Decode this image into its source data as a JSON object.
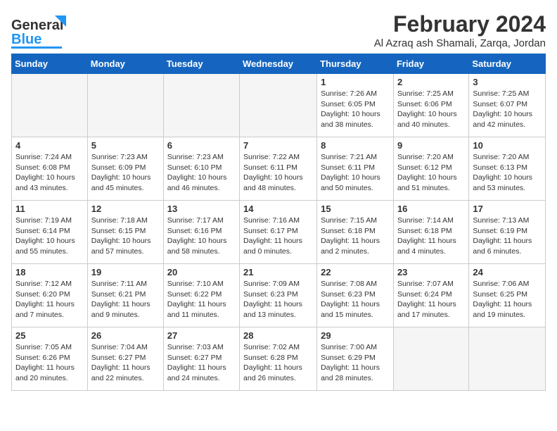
{
  "header": {
    "logo_line1": "General",
    "logo_line2": "Blue",
    "month_year": "February 2024",
    "location": "Al Azraq ash Shamali, Zarqa, Jordan"
  },
  "days_of_week": [
    "Sunday",
    "Monday",
    "Tuesday",
    "Wednesday",
    "Thursday",
    "Friday",
    "Saturday"
  ],
  "weeks": [
    [
      {
        "day": "",
        "info": ""
      },
      {
        "day": "",
        "info": ""
      },
      {
        "day": "",
        "info": ""
      },
      {
        "day": "",
        "info": ""
      },
      {
        "day": "1",
        "info": "Sunrise: 7:26 AM\nSunset: 6:05 PM\nDaylight: 10 hours\nand 38 minutes."
      },
      {
        "day": "2",
        "info": "Sunrise: 7:25 AM\nSunset: 6:06 PM\nDaylight: 10 hours\nand 40 minutes."
      },
      {
        "day": "3",
        "info": "Sunrise: 7:25 AM\nSunset: 6:07 PM\nDaylight: 10 hours\nand 42 minutes."
      }
    ],
    [
      {
        "day": "4",
        "info": "Sunrise: 7:24 AM\nSunset: 6:08 PM\nDaylight: 10 hours\nand 43 minutes."
      },
      {
        "day": "5",
        "info": "Sunrise: 7:23 AM\nSunset: 6:09 PM\nDaylight: 10 hours\nand 45 minutes."
      },
      {
        "day": "6",
        "info": "Sunrise: 7:23 AM\nSunset: 6:10 PM\nDaylight: 10 hours\nand 46 minutes."
      },
      {
        "day": "7",
        "info": "Sunrise: 7:22 AM\nSunset: 6:11 PM\nDaylight: 10 hours\nand 48 minutes."
      },
      {
        "day": "8",
        "info": "Sunrise: 7:21 AM\nSunset: 6:11 PM\nDaylight: 10 hours\nand 50 minutes."
      },
      {
        "day": "9",
        "info": "Sunrise: 7:20 AM\nSunset: 6:12 PM\nDaylight: 10 hours\nand 51 minutes."
      },
      {
        "day": "10",
        "info": "Sunrise: 7:20 AM\nSunset: 6:13 PM\nDaylight: 10 hours\nand 53 minutes."
      }
    ],
    [
      {
        "day": "11",
        "info": "Sunrise: 7:19 AM\nSunset: 6:14 PM\nDaylight: 10 hours\nand 55 minutes."
      },
      {
        "day": "12",
        "info": "Sunrise: 7:18 AM\nSunset: 6:15 PM\nDaylight: 10 hours\nand 57 minutes."
      },
      {
        "day": "13",
        "info": "Sunrise: 7:17 AM\nSunset: 6:16 PM\nDaylight: 10 hours\nand 58 minutes."
      },
      {
        "day": "14",
        "info": "Sunrise: 7:16 AM\nSunset: 6:17 PM\nDaylight: 11 hours\nand 0 minutes."
      },
      {
        "day": "15",
        "info": "Sunrise: 7:15 AM\nSunset: 6:18 PM\nDaylight: 11 hours\nand 2 minutes."
      },
      {
        "day": "16",
        "info": "Sunrise: 7:14 AM\nSunset: 6:18 PM\nDaylight: 11 hours\nand 4 minutes."
      },
      {
        "day": "17",
        "info": "Sunrise: 7:13 AM\nSunset: 6:19 PM\nDaylight: 11 hours\nand 6 minutes."
      }
    ],
    [
      {
        "day": "18",
        "info": "Sunrise: 7:12 AM\nSunset: 6:20 PM\nDaylight: 11 hours\nand 7 minutes."
      },
      {
        "day": "19",
        "info": "Sunrise: 7:11 AM\nSunset: 6:21 PM\nDaylight: 11 hours\nand 9 minutes."
      },
      {
        "day": "20",
        "info": "Sunrise: 7:10 AM\nSunset: 6:22 PM\nDaylight: 11 hours\nand 11 minutes."
      },
      {
        "day": "21",
        "info": "Sunrise: 7:09 AM\nSunset: 6:23 PM\nDaylight: 11 hours\nand 13 minutes."
      },
      {
        "day": "22",
        "info": "Sunrise: 7:08 AM\nSunset: 6:23 PM\nDaylight: 11 hours\nand 15 minutes."
      },
      {
        "day": "23",
        "info": "Sunrise: 7:07 AM\nSunset: 6:24 PM\nDaylight: 11 hours\nand 17 minutes."
      },
      {
        "day": "24",
        "info": "Sunrise: 7:06 AM\nSunset: 6:25 PM\nDaylight: 11 hours\nand 19 minutes."
      }
    ],
    [
      {
        "day": "25",
        "info": "Sunrise: 7:05 AM\nSunset: 6:26 PM\nDaylight: 11 hours\nand 20 minutes."
      },
      {
        "day": "26",
        "info": "Sunrise: 7:04 AM\nSunset: 6:27 PM\nDaylight: 11 hours\nand 22 minutes."
      },
      {
        "day": "27",
        "info": "Sunrise: 7:03 AM\nSunset: 6:27 PM\nDaylight: 11 hours\nand 24 minutes."
      },
      {
        "day": "28",
        "info": "Sunrise: 7:02 AM\nSunset: 6:28 PM\nDaylight: 11 hours\nand 26 minutes."
      },
      {
        "day": "29",
        "info": "Sunrise: 7:00 AM\nSunset: 6:29 PM\nDaylight: 11 hours\nand 28 minutes."
      },
      {
        "day": "",
        "info": ""
      },
      {
        "day": "",
        "info": ""
      }
    ]
  ]
}
